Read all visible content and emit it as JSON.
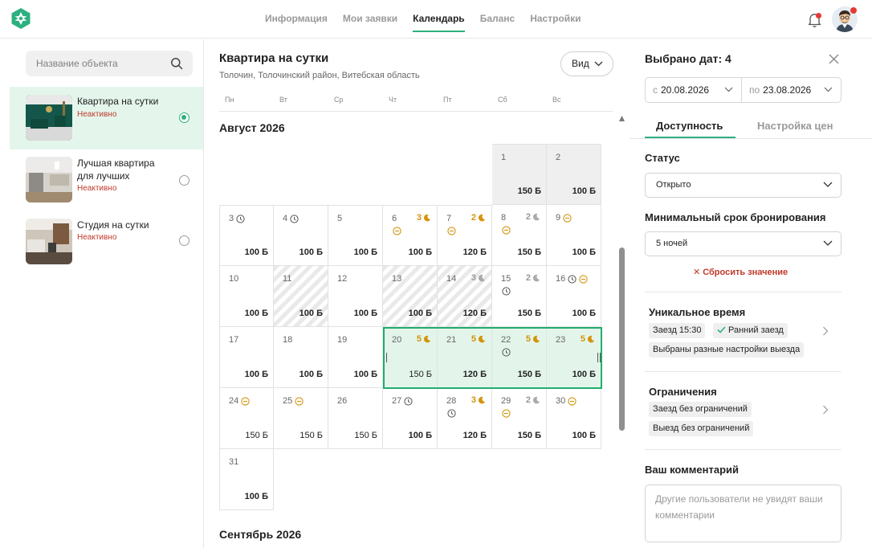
{
  "nav": {
    "items": [
      "Информация",
      "Мои заявки",
      "Календарь",
      "Баланс",
      "Настройки"
    ],
    "active_index": 2
  },
  "sidebar": {
    "search_placeholder": "Название объекта",
    "objects": [
      {
        "name": "Квартира на сутки",
        "status": "Неактивно",
        "selected": true
      },
      {
        "name": "Лучшая квартира для лучших",
        "status": "Неактивно",
        "selected": false
      },
      {
        "name": "Студия на сутки",
        "status": "Неактивно",
        "selected": false
      }
    ]
  },
  "calendar": {
    "title": "Квартира на сутки",
    "address": "Толочин, Толочинский район, Витебская область",
    "view_label": "Вид",
    "weekdays": [
      "Пн",
      "Вт",
      "Ср",
      "Чт",
      "Пт",
      "Сб",
      "Вс"
    ],
    "months": [
      {
        "label": "Август 2026"
      },
      {
        "label": "Сентябрь 2026"
      }
    ],
    "days": [
      {
        "d": "1",
        "price": "150 Б",
        "style": "past"
      },
      {
        "d": "2",
        "price": "100 Б",
        "style": "past"
      },
      {
        "d": "3",
        "price": "100 Б",
        "clock": true
      },
      {
        "d": "4",
        "price": "100 Б",
        "clock": true
      },
      {
        "d": "5",
        "price": "100 Б"
      },
      {
        "d": "6",
        "price": "100 Б",
        "nights": "3",
        "minus": true
      },
      {
        "d": "7",
        "price": "120 Б",
        "nights": "2",
        "minus": true
      },
      {
        "d": "8",
        "price": "150 Б",
        "nights": "2",
        "nights_grey": true,
        "minus": true
      },
      {
        "d": "9",
        "price": "100 Б",
        "minus_inline": true
      },
      {
        "d": "10",
        "price": "100 Б"
      },
      {
        "d": "11",
        "price": "100 Б",
        "style": "hatch"
      },
      {
        "d": "12",
        "price": "100 Б"
      },
      {
        "d": "13",
        "price": "100 Б",
        "style": "hatch"
      },
      {
        "d": "14",
        "price": "120 Б",
        "style": "hatch",
        "nights": "3",
        "nights_grey": true
      },
      {
        "d": "15",
        "price": "150 Б",
        "nights": "2",
        "nights_grey": true,
        "clock_below": true
      },
      {
        "d": "16",
        "price": "100 Б",
        "clock": true,
        "minus_inline": true
      },
      {
        "d": "17",
        "price": "100 Б"
      },
      {
        "d": "18",
        "price": "100 Б"
      },
      {
        "d": "19",
        "price": "100 Б"
      },
      {
        "d": "20",
        "price": "150 Б",
        "style": "sel",
        "nights": "5",
        "price_plain": true
      },
      {
        "d": "21",
        "price": "120 Б",
        "style": "sel",
        "nights": "5"
      },
      {
        "d": "22",
        "price": "150 Б",
        "style": "sel",
        "nights": "5",
        "clock_below": true
      },
      {
        "d": "23",
        "price": "100 Б",
        "style": "sel",
        "nights": "5"
      },
      {
        "d": "24",
        "price": "150 Б",
        "minus_inline": true,
        "price_plain": true
      },
      {
        "d": "25",
        "price": "150 Б",
        "minus_inline": true,
        "price_plain": true
      },
      {
        "d": "26",
        "price": "150 Б",
        "price_plain": true
      },
      {
        "d": "27",
        "price": "100 Б",
        "clock": true
      },
      {
        "d": "28",
        "price": "120 Б",
        "nights": "3",
        "clock_below": true
      },
      {
        "d": "29",
        "price": "150 Б",
        "nights": "2",
        "nights_grey": true,
        "minus": true
      },
      {
        "d": "30",
        "price": "100 Б",
        "minus_inline": true
      },
      {
        "d": "31",
        "price": "100 Б"
      }
    ]
  },
  "panel": {
    "title": "Выбрано дат: 4",
    "date_from_prefix": "с",
    "date_from": "20.08.2026",
    "date_to_prefix": "по",
    "date_to": "23.08.2026",
    "tabs": [
      "Доступность",
      "Настройка цен"
    ],
    "status_label": "Статус",
    "status_value": "Открыто",
    "min_label": "Минимальный срок бронирования",
    "min_value": "5 ночей",
    "reset_label": "Сбросить значение",
    "unique_title": "Уникальное время",
    "unique_chips": [
      "Заезд 15:30",
      "Ранний заезд",
      "Выбраны разные настройки выезда"
    ],
    "limits_title": "Ограничения",
    "limits_chips": [
      "Заезд без ограничений",
      "Выезд без ограничений"
    ],
    "comment_label": "Ваш комментарий",
    "comment_placeholder": "Другие пользователи не увидят ваши комментарии"
  },
  "colors": {
    "accent": "#2db07f",
    "status_inactive": "#c0392b",
    "nights": "#d4940b"
  }
}
